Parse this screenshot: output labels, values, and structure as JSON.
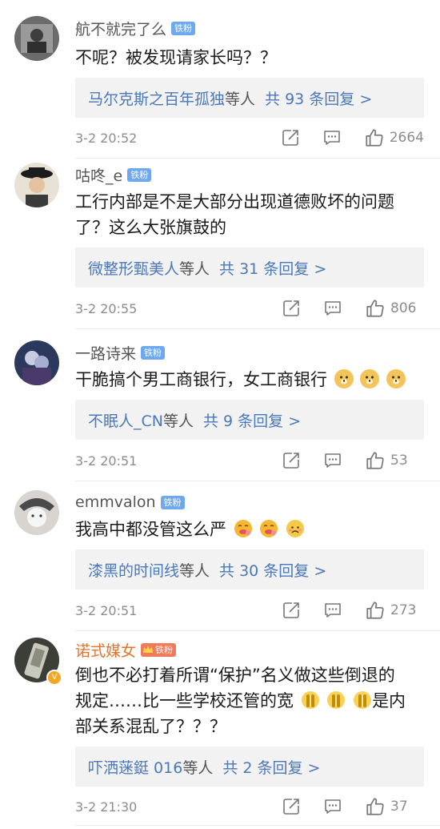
{
  "comments": [
    {
      "username": "航不就完了么",
      "badge": "铁粉",
      "text": "不呢？被发现请家长吗？？",
      "reply_users": "马尔克斯之百年孤独",
      "reply_mid": "等人",
      "reply_count": "共 93 条回复 >",
      "time": "3-2 20:52",
      "likes": "2664"
    },
    {
      "username": "咕咚_e",
      "badge": "铁粉",
      "text_line1": "工行内部是不是大部分出现道德败坏的问题",
      "text_line2": "了？这么大张旗鼓的",
      "reply_users": "微整形甄美人",
      "reply_mid": "等人",
      "reply_count": "共 31 条回复 >",
      "time": "3-2 20:55",
      "likes": "806"
    },
    {
      "username": "一路诗来",
      "badge": "铁粉",
      "text": "干脆搞个男工商银行，女工商银行",
      "emoji": [
        "doge",
        "doge",
        "doge"
      ],
      "reply_users": "不眠人_CN",
      "reply_mid": "等人",
      "reply_count": "共 9 条回复 >",
      "time": "3-2 20:51",
      "likes": "53"
    },
    {
      "username": "emmvalon",
      "badge": "铁粉",
      "text": "我高中都没管这么严",
      "emoji": [
        "drool",
        "drool",
        "sad"
      ],
      "reply_users": "漆黑的时间线",
      "reply_mid": "等人",
      "reply_count": "共 30 条回复 >",
      "time": "3-2 20:51",
      "likes": "273"
    },
    {
      "username": "诺式媒女",
      "badge": "铁粉",
      "verified": "V",
      "text_line1": "倒也不必打着所谓“保护”名义做这些倒退的",
      "text_line2a": "规定……比一些学校还管的宽",
      "emoji": [
        "pray",
        "pray",
        "pray"
      ],
      "text_line2b": "是内",
      "text_line3": "部关系混乱了？？？",
      "reply_users": "吓洒蒾鋌 016",
      "reply_mid": "等人",
      "reply_count": "共 2 条回复 >",
      "time": "3-2 21:30",
      "likes": "37"
    }
  ],
  "colors": {
    "link": "#4a78b8",
    "badge": "#6ea8f0",
    "gold_name": "#e3742b",
    "reply_bg": "#f2f2f2"
  },
  "icons": [
    "share-icon",
    "comment-icon",
    "like-icon"
  ]
}
